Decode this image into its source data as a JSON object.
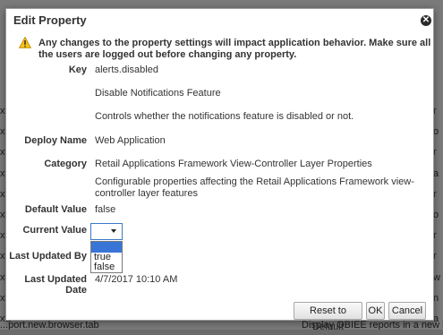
{
  "background": {
    "left_fragments": [
      "xts.",
      "xts.",
      "xts.",
      "xts.",
      "xts.",
      "xts.",
      "xts.",
      "xts.",
      "xts.",
      "xts.",
      "xts."
    ],
    "right_fragments": [
      "r",
      "o",
      "r",
      "a",
      "r",
      "o",
      "r",
      "r",
      "w",
      "n",
      "a"
    ],
    "bottom_left": "...port.new.browser.tab",
    "bottom_right": "Display OBIEE reports in a new b"
  },
  "dialog": {
    "title": "Edit Property",
    "close_icon": "close-circle-icon",
    "warning_icon": "warning-triangle-icon",
    "warning_text": "Any changes to the property settings will impact application behavior. Make sure all the users are logged out before changing any property.",
    "fields": {
      "key_label": "Key",
      "key_value": "alerts.disabled",
      "key_name": "Disable Notifications Feature",
      "key_description": "Controls whether the notifications feature is disabled or not.",
      "deploy_name_label": "Deploy Name",
      "deploy_name_value": "Web Application",
      "category_label": "Category",
      "category_value": "Retail Applications Framework View-Controller Layer Properties",
      "category_description": "Configurable properties affecting the Retail Applications Framework view-controller layer features",
      "default_value_label": "Default Value",
      "default_value": "false",
      "current_value_label": "Current Value",
      "current_value": "",
      "current_value_options": [
        "",
        "true",
        "false"
      ],
      "last_updated_by_label": "Last Updated By",
      "last_updated_by_value": "",
      "last_updated_date_label": "Last Updated Date",
      "last_updated_date_value": "4/7/2017 10:10 AM"
    },
    "buttons": {
      "reset": "Reset to Default",
      "ok": "OK",
      "cancel": "Cancel"
    }
  }
}
